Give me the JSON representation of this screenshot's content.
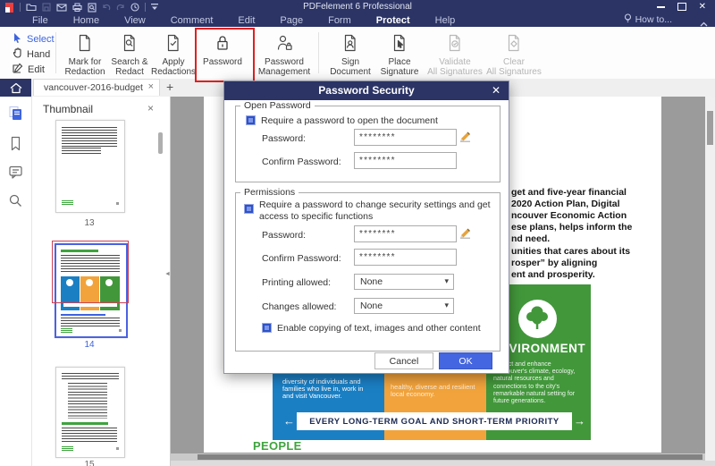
{
  "window": {
    "title": "PDFelement 6 Professional",
    "close_glyph": "✕"
  },
  "menubar": {
    "items": [
      "File",
      "Home",
      "View",
      "Comment",
      "Edit",
      "Page",
      "Form",
      "Protect",
      "Help"
    ],
    "active_item": "Protect",
    "howto": "How to..."
  },
  "ribbon": {
    "select": "Select",
    "hand": "Hand",
    "edit": "Edit",
    "buttons": [
      {
        "line1": "Mark for",
        "line2": "Redaction",
        "enabled": true
      },
      {
        "line1": "Search &",
        "line2": "Redact",
        "enabled": true
      },
      {
        "line1": "Apply",
        "line2": "Redactions",
        "enabled": true
      },
      {
        "line1": "Password",
        "line2": "",
        "enabled": true,
        "highlighted": true
      },
      {
        "line1": "Password",
        "line2": "Management",
        "enabled": true
      },
      {
        "line1": "Sign",
        "line2": "Document",
        "enabled": true
      },
      {
        "line1": "Place",
        "line2": "Signature",
        "enabled": true
      },
      {
        "line1": "Validate",
        "line2": "All Signatures",
        "enabled": false
      },
      {
        "line1": "Clear",
        "line2": "All Signatures",
        "enabled": false
      }
    ]
  },
  "tabbar": {
    "document_tab": "vancouver-2016-budget",
    "close_glyph": "×",
    "new_tab_glyph": "+"
  },
  "thumbnails": {
    "panel_title": "Thumbnail",
    "close_glyph": "×",
    "page13": "13",
    "page14": "14",
    "page15": "15",
    "selected_page": "14"
  },
  "dialog": {
    "title": "Password Security",
    "close_glyph": "✕",
    "caret": "▾",
    "open_group": {
      "legend": "Open Password",
      "require_label": "Require a password to open the document",
      "require_checked": true,
      "password_label": "Password:",
      "password_value": "********",
      "confirm_label": "Confirm Password:",
      "confirm_value": "********"
    },
    "perm_group": {
      "legend": "Permissions",
      "require_line1": "Require a password to change security settings and get",
      "require_line2": "access to specific functions",
      "require_checked": true,
      "password_label": "Password:",
      "password_value": "********",
      "confirm_label": "Confirm Password:",
      "confirm_value": "********",
      "printing_label": "Printing allowed:",
      "printing_value": "None",
      "changes_label": "Changes allowed:",
      "changes_value": "None",
      "copy_label": "Enable copying of text, images and other content",
      "copy_checked": true
    },
    "cancel": "Cancel",
    "ok": "OK"
  },
  "document": {
    "para1": [
      "get and five-year financial",
      "2020 Action Plan, Digital",
      "ncouver Economic Action",
      "ese plans, helps inform the",
      "nd need."
    ],
    "para2": [
      "unities that cares about its",
      "rosper” by aligning",
      "ent and prosperity."
    ],
    "environment_title": "ENVIRONMENT",
    "environment_lines": [
      "Protect and enhance",
      "Vancouver's climate, ecology,",
      "natural resources and",
      "connections to the city's",
      "remarkable natural setting for",
      "future generations."
    ],
    "blue_lines": [
      "diversity of individuals and",
      "families who live in, work in",
      "and visit Vancouver."
    ],
    "orange_lines": [
      "healthy, diverse and resilient",
      "local economy."
    ],
    "banner": "EVERY LONG-TERM GOAL AND SHORT-TERM PRIORITY",
    "arrow_left": "←",
    "arrow_right": "→",
    "people": "PEOPLE"
  },
  "colors": {
    "navy": "#2B3465",
    "accent_blue": "#3E64DE",
    "ok_blue": "#4466E0",
    "highlight_red": "#DE2020",
    "doc_blue": "#1B7FC4",
    "doc_orange": "#F2A33C",
    "doc_green": "#42973B",
    "people_green": "#3FA33F"
  }
}
